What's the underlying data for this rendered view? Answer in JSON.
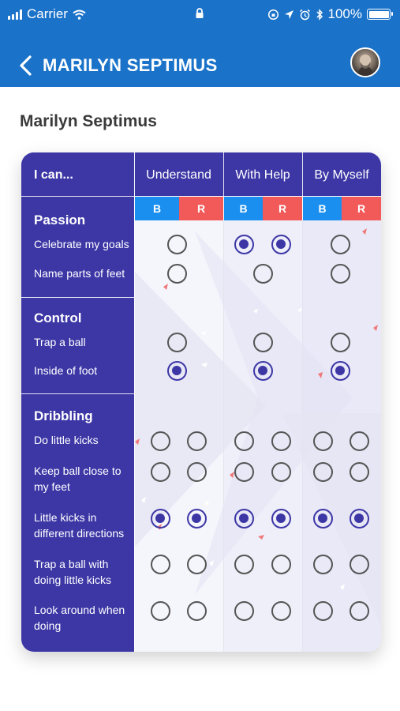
{
  "status_bar": {
    "carrier": "Carrier",
    "battery": "100%",
    "icons": [
      "signal-icon",
      "wifi-icon",
      "lock-icon",
      "orientation-lock-icon",
      "location-icon",
      "alarm-icon",
      "bluetooth-icon",
      "battery-icon"
    ]
  },
  "nav": {
    "title": "MARILYN SEPTIMUS",
    "back_icon": "chevron-left-icon",
    "avatar": "user-avatar"
  },
  "page": {
    "title": "Marilyn Septimus"
  },
  "table": {
    "corner_label": "I can...",
    "columns": [
      "Understand",
      "With Help",
      "By Myself"
    ],
    "sub_labels": {
      "b": "B",
      "r": "R"
    },
    "sections": [
      {
        "title": "Passion",
        "items": [
          {
            "label": "Celebrate my goals",
            "values": {
              "understand": [
                false
              ],
              "with_help": [
                true,
                true
              ],
              "by_myself": [
                false
              ]
            }
          },
          {
            "label": "Name parts of feet",
            "values": {
              "understand": [
                false
              ],
              "with_help": [
                false
              ],
              "by_myself": [
                false
              ]
            }
          }
        ]
      },
      {
        "title": "Control",
        "items": [
          {
            "label": "Trap a ball",
            "values": {
              "understand": [
                false
              ],
              "with_help": [
                false
              ],
              "by_myself": [
                false
              ]
            }
          },
          {
            "label": "Inside of foot",
            "values": {
              "understand": [
                true
              ],
              "with_help": [
                true
              ],
              "by_myself": [
                true
              ]
            }
          }
        ]
      },
      {
        "title": "Dribbling",
        "items": [
          {
            "label": "Do little kicks",
            "values": {
              "understand": [
                false,
                false
              ],
              "with_help": [
                false,
                false
              ],
              "by_myself": [
                false,
                false
              ]
            }
          },
          {
            "label": "Keep ball close to my feet",
            "values": {
              "understand": [
                false,
                false
              ],
              "with_help": [
                false,
                false
              ],
              "by_myself": [
                false,
                false
              ]
            }
          },
          {
            "label": "Little kicks in different directions",
            "values": {
              "understand": [
                true,
                true
              ],
              "with_help": [
                true,
                true
              ],
              "by_myself": [
                true,
                true
              ]
            }
          },
          {
            "label": "Trap a ball with doing little kicks",
            "values": {
              "understand": [
                false,
                false
              ],
              "with_help": [
                false,
                false
              ],
              "by_myself": [
                false,
                false
              ]
            }
          },
          {
            "label": "Look around when doing",
            "values": {
              "understand": [
                false,
                false
              ],
              "with_help": [
                false,
                false
              ],
              "by_myself": [
                false,
                false
              ]
            }
          }
        ]
      }
    ]
  },
  "colors": {
    "header": "#1a72c9",
    "panel": "#3d37a6",
    "b_badge": "#1a8ff0",
    "r_badge": "#f25a5a"
  }
}
